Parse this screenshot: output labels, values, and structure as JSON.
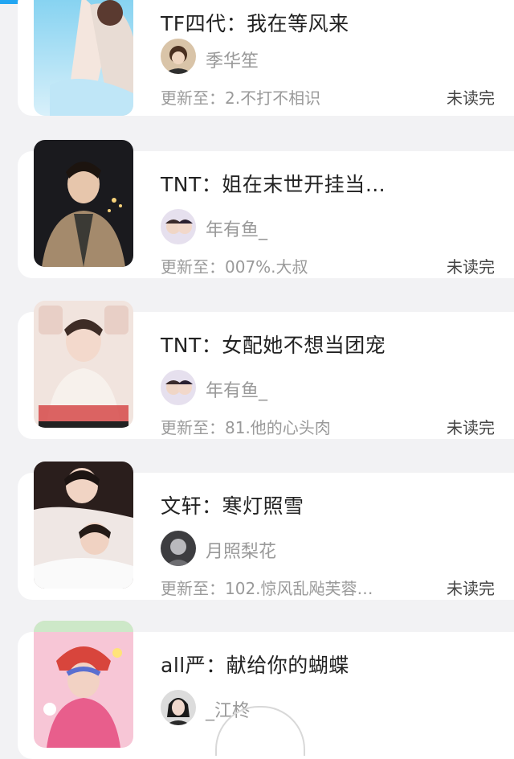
{
  "books": [
    {
      "title": "TF四代：我在等风来",
      "author": "季华笙",
      "update": "更新至：2.不打不相识",
      "status": "未读完",
      "cover_icon": "book-cover-image",
      "avatar_icon": "author-avatar-image"
    },
    {
      "title": "TNT：姐在末世开挂当…",
      "author": "年有鱼_",
      "update": "更新至：007%.大叔",
      "status": "未读完",
      "cover_icon": "book-cover-image",
      "avatar_icon": "author-avatar-image"
    },
    {
      "title": "TNT：女配她不想当团宠",
      "author": "年有鱼_",
      "update": "更新至：81.他的心头肉",
      "status": "未读完",
      "cover_icon": "book-cover-image",
      "avatar_icon": "author-avatar-image"
    },
    {
      "title": "文轩：寒灯照雪",
      "author": "月照梨花",
      "update": "更新至：102.惊风乱飐芙蓉…",
      "status": "未读完",
      "cover_icon": "book-cover-image",
      "avatar_icon": "author-avatar-image"
    },
    {
      "title": "all严：献给你的蝴蝶",
      "author": "_江柊",
      "update": "",
      "status": "",
      "cover_icon": "book-cover-image",
      "avatar_icon": "author-avatar-image"
    }
  ],
  "colors": {
    "accent": "#22a6f2",
    "background": "#f2f2f4",
    "card": "#ffffff"
  }
}
